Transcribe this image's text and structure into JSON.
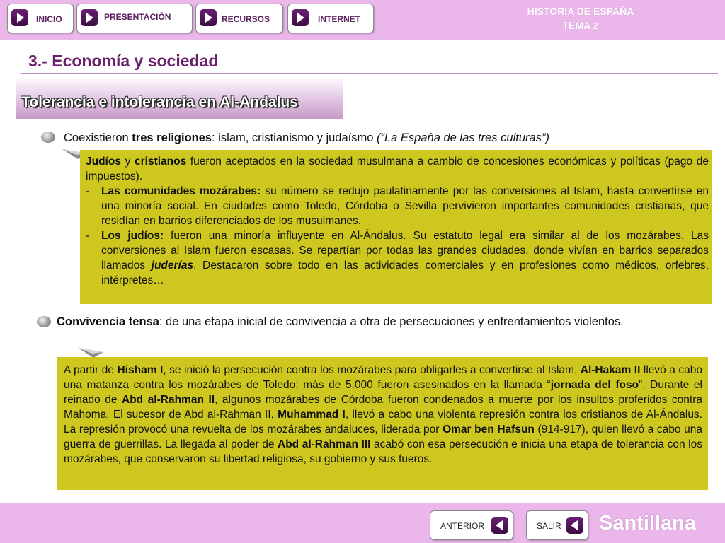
{
  "header": {
    "nav": [
      {
        "label": "INICIO"
      },
      {
        "label": "PRESENTACIÓN"
      },
      {
        "label": "RECURSOS"
      },
      {
        "label": "INTERNET"
      }
    ],
    "course_line1": "HISTORIA DE ESPAÑA",
    "course_line2": "TEMA 2"
  },
  "section_title": "3.- Economía y sociedad",
  "subtitle": "Tolerancia e intolerancia en Al-Andalus",
  "bullet1": {
    "pre": "Coexistieron ",
    "bold": "tres religiones",
    "post": ": islam, cristianismo y judaísmo  ",
    "italic": "(“La España de las tres culturas”)"
  },
  "box1": {
    "intro_b1": "Judíos",
    "intro_t1": " y ",
    "intro_b2": "cristianos",
    "intro_t2": " fueron aceptados en la sociedad musulmana a cambio de concesiones económicas y políticas (pago de impuestos).",
    "items": [
      {
        "dash": "-",
        "bold": "Las comunidades mozárabes:",
        "text": " su número se redujo paulatinamente por las conversiones al Islam, hasta convertirse en una minoría social. En ciudades como Toledo, Córdoba o Sevilla pervivieron importantes comunidades cristianas, que residían en barrios diferenciados de los musulmanes."
      },
      {
        "dash": "-",
        "bold": "Los judíos:",
        "text": " fueron una minoría influyente en Al-Ándalus. Su estatuto legal era similar al de los mozárabes. Las conversiones al Islam fueron escasas. Se repartían por todas las grandes ciudades, donde vivían en barrios separados llamados ",
        "italic_bold": "juderías",
        "text2": ". Destacaron sobre todo en las actividades comerciales y en profesiones como médicos, orfebres, intérpretes…"
      }
    ]
  },
  "bullet2": {
    "bold": "Convivencia tensa",
    "post": ": de una etapa inicial de convivencia a otra de persecuciones y enfrentamientos violentos."
  },
  "box2": {
    "t1": "A partir de ",
    "b1": "Hisham I",
    "t2": ", se inició la persecución contra los mozárabes para obligarles a convertirse al Islam. ",
    "b2": "Al-Hakam II",
    "t3": " llevó a cabo una matanza contra los mozárabes de Toledo: más de 5.000 fueron asesinados en la llamada “",
    "b3": "jornada del foso",
    "t4": "”. Durante el reinado de ",
    "b4": "Abd al-Rahman II",
    "t5": ", algunos mozárabes de Córdoba fueron condenados a muerte por los insultos proferidos contra Mahoma. El sucesor de Abd al-Rahman II, ",
    "b5": "Muhammad I",
    "t6": ", llevó a cabo una violenta represión contra los cristianos de Al-Ándalus. La represión provocó una revuelta de los mozárabes andaluces, liderada por ",
    "b6": "Omar ben Hafsun",
    "t7": " (914-917), quien llevó a cabo una guerra de guerrillas. La llegada al poder de ",
    "b7": "Abd al-Rahman III",
    "t8": " acabó con esa persecución e inicia una etapa de tolerancia con los mozárabes, que conservaron su libertad religiosa, su gobierno y sus fueros."
  },
  "footer": {
    "prev_label": "ANTERIOR",
    "exit_label": "SALIR",
    "brand": "Santillana"
  },
  "colors": {
    "bar": "#ebb7eb",
    "olive": "#cdc720",
    "title": "#6b1e6b",
    "button_arrow": "#4a1250"
  }
}
